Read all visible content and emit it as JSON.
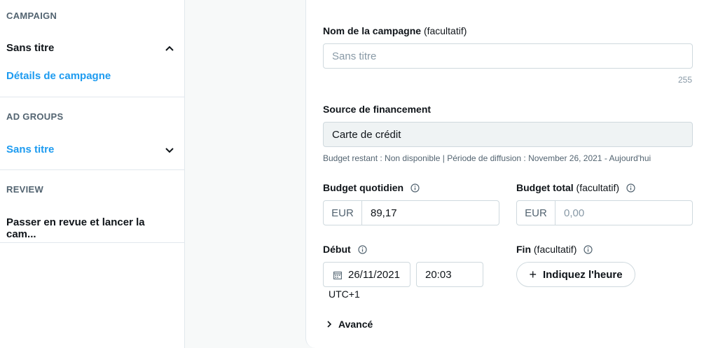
{
  "sidebar": {
    "campaign_heading": "CAMPAIGN",
    "campaign_name": "Sans titre",
    "campaign_details_link": "Détails de campagne",
    "adgroups_heading": "AD GROUPS",
    "adgroup_name": "Sans titre",
    "review_heading": "REVIEW",
    "review_item": "Passer en revue et lancer la cam..."
  },
  "form": {
    "campaign_name": {
      "label": "Nom de la campagne",
      "optional": "(facultatif)",
      "placeholder": "Sans titre",
      "char_limit": "255"
    },
    "funding": {
      "label": "Source de financement",
      "value": "Carte de crédit",
      "info": "Budget restant : Non disponible | Période de diffusion : November 26, 2021 - Aujourd'hui"
    },
    "daily_budget": {
      "label": "Budget quotidien",
      "currency": "EUR",
      "value": "89,17"
    },
    "total_budget": {
      "label": "Budget total",
      "optional": "(facultatif)",
      "currency": "EUR",
      "placeholder": "0,00"
    },
    "start": {
      "label": "Début",
      "date": "26/11/2021",
      "time": "20:03",
      "timezone": "UTC+1"
    },
    "end": {
      "label": "Fin",
      "optional": "(facultatif)",
      "button": "Indiquez l'heure"
    },
    "advanced": "Avancé"
  },
  "colors": {
    "accent": "#1d9bf0",
    "text": "#0f1419",
    "muted": "#536471",
    "border": "#cfd9de"
  }
}
